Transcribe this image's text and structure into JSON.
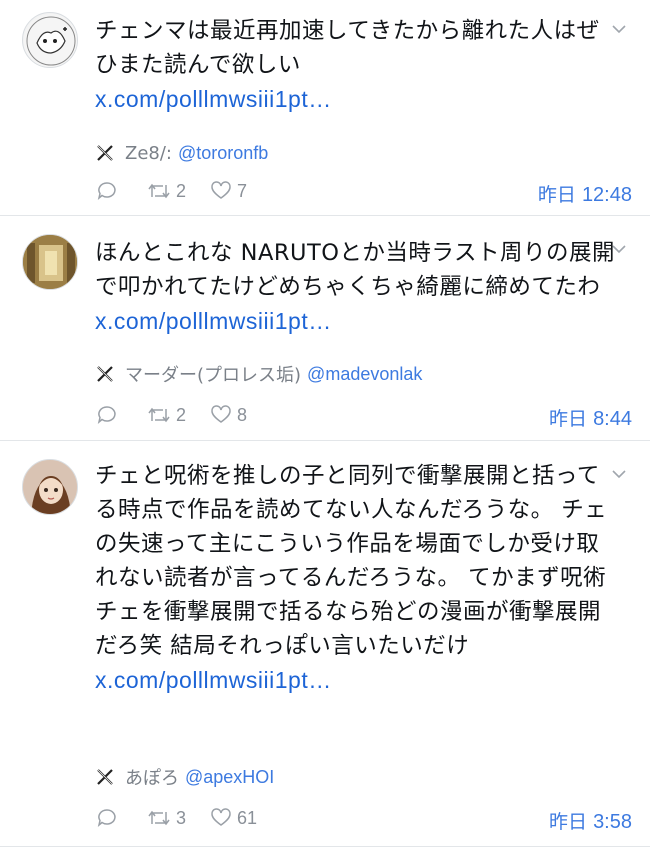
{
  "tweets": [
    {
      "text": "チェンマは最近再加速してきたから離れた人はぜひまた読んで欲しい",
      "link": "x.com/polllmwsiii1pt…",
      "author_name": "Ze8/:",
      "author_handle": "@tororonfb",
      "reply_count": "",
      "retweet_count": "2",
      "like_count": "7",
      "time_day": "昨日",
      "time_clock": "12:48"
    },
    {
      "text": "ほんとこれな NARUTOとか当時ラスト周りの展開で叩かれてたけどめちゃくちゃ綺麗に締めてたわ ",
      "link": "x.com/polllmwsiii1pt…",
      "author_name": "マーダー(プロレス垢)",
      "author_handle": "@madevonlak",
      "reply_count": "",
      "retweet_count": "2",
      "like_count": "8",
      "time_day": "昨日",
      "time_clock": "8:44"
    },
    {
      "text": "チェと呪術を推しの子と同列で衝撃展開と括ってる時点で作品を読めてない人なんだろうな。 チェの失速って主にこういう作品を場面でしか受け取れない読者が言ってるんだろうな。 てかまず呪術チェを衝撃展開で括るなら殆どの漫画が衝撃展開だろ笑 結局それっぽい言いたいだけ",
      "link": "x.com/polllmwsiii1pt…",
      "author_name": "あぽろ",
      "author_handle": "@apexHOI",
      "reply_count": "",
      "retweet_count": "3",
      "like_count": "61",
      "time_day": "昨日",
      "time_clock": "3:58"
    }
  ],
  "icons": {
    "reply": "reply-icon",
    "retweet": "retweet-icon",
    "like": "heart-icon",
    "source": "x-logo-icon",
    "menu": "chevron-down-icon"
  },
  "colors": {
    "link": "#1d64d6",
    "handle": "#3d7ae0",
    "muted": "#8a9098",
    "divider": "#e3e6e9"
  }
}
